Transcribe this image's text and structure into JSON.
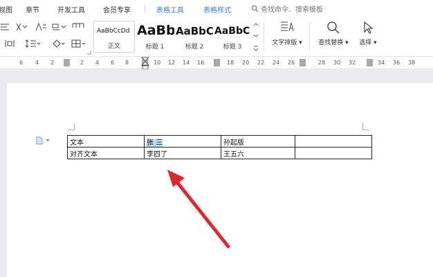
{
  "menu": {
    "items": [
      "视图",
      "章节",
      "开发工具",
      "会员专享",
      "表格工具",
      "表格样式"
    ],
    "search_placeholder": "查找命令、搜索模板"
  },
  "ribbon": {
    "styles": [
      {
        "sample": "AaBbCcDd",
        "name": "正文"
      },
      {
        "sample": "AaBb",
        "name": "标题 1"
      },
      {
        "sample": "AaBbC",
        "name": "标题 2"
      },
      {
        "sample": "AaBbC",
        "name": "标题 3"
      }
    ],
    "text_layout_label": "文字排版",
    "find_replace_label": "查找替换",
    "select_label": "选择"
  },
  "ruler": {
    "ticks": [
      "6",
      "4",
      "2",
      "2",
      "4",
      "6",
      "8",
      "10",
      "12",
      "14",
      "16",
      "18",
      "20",
      "22",
      "24",
      "26",
      "28",
      "30",
      "32",
      "34",
      "36",
      "38",
      "40",
      "42",
      "44",
      "46"
    ]
  },
  "table": {
    "rows": [
      [
        "文本",
        "张 三",
        "孙起版",
        ""
      ],
      [
        "对齐文本",
        "李四了",
        "王五六",
        ""
      ]
    ]
  },
  "colors": {
    "accent": "#3b7be0",
    "arrow": "#e0272b",
    "highlight": "#b6ddea"
  }
}
